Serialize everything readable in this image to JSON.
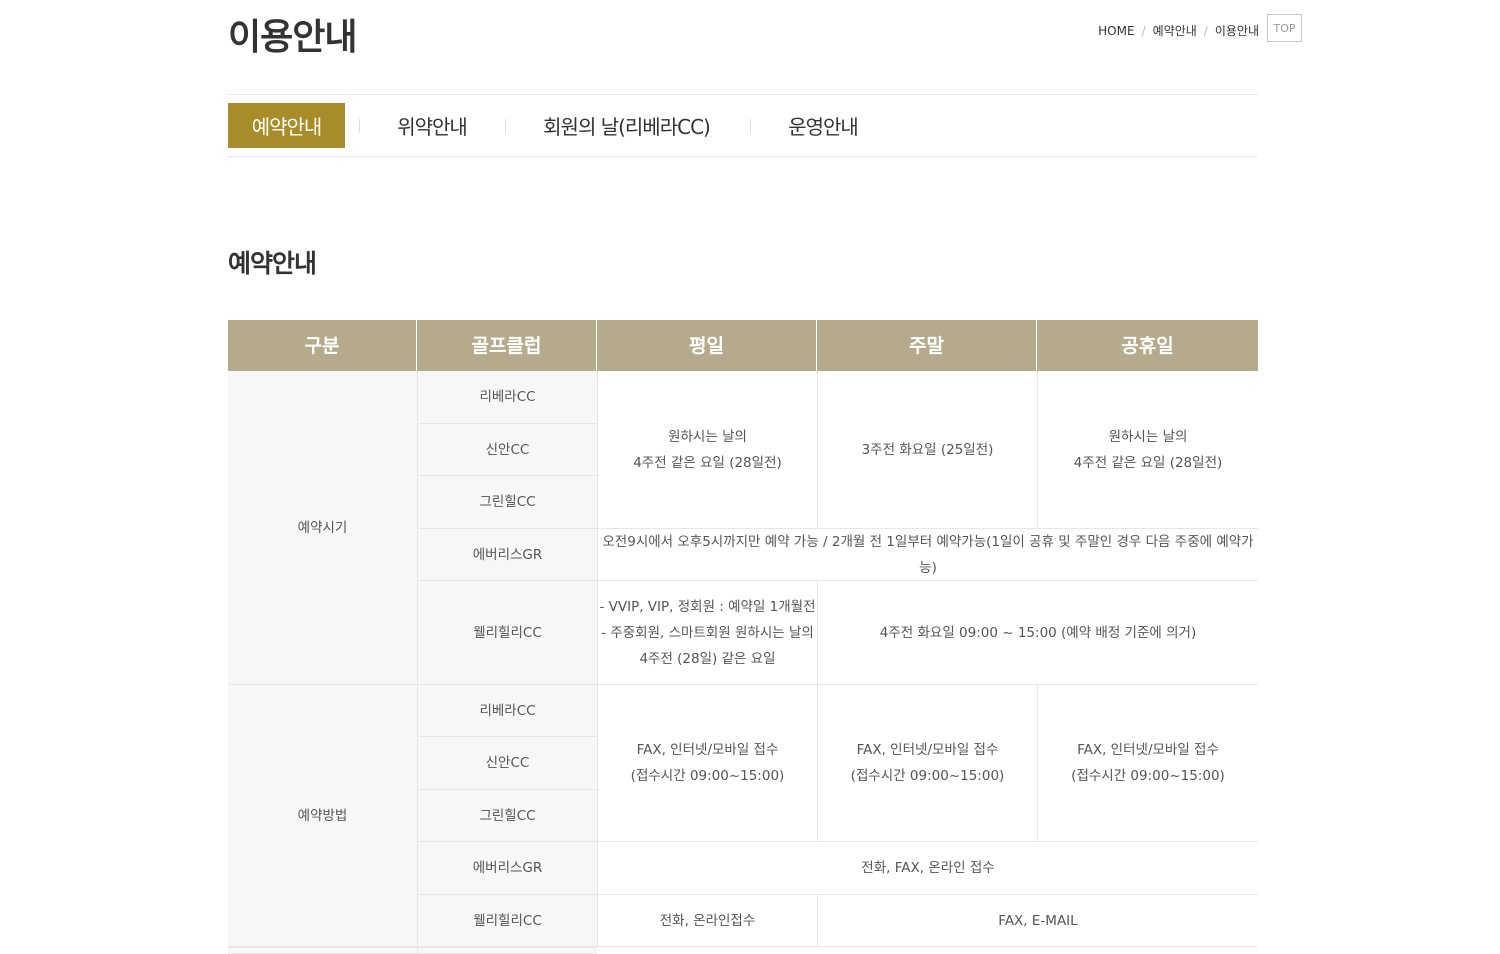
{
  "page": {
    "title": "이용안내"
  },
  "breadcrumb": [
    "HOME",
    "예약안내",
    "이용안내"
  ],
  "top_button": "TOP",
  "tabs": [
    {
      "label": "예약안내",
      "active": true
    },
    {
      "label": "위약안내",
      "active": false
    },
    {
      "label": "회원의 날(리베라CC)",
      "active": false
    },
    {
      "label": "운영안내",
      "active": false
    }
  ],
  "section_title": "예약안내",
  "colors": {
    "accent": "#a88c2a",
    "table_header": "#b5ab8c",
    "cell_bg": "#f7f7f7",
    "border": "#e6e6e6"
  },
  "table": {
    "headers": [
      "구분",
      "골프클럽",
      "평일",
      "주말",
      "공휴일"
    ],
    "categories": [
      "예약시기",
      "예약방법"
    ],
    "clubs": [
      "리베라CC",
      "신안CC",
      "그린힐CC",
      "에버리스GR",
      "웰리힐리CC"
    ],
    "reservation_time": {
      "group_weekday": [
        "원하시는 날의",
        "4주전 같은 요일 (28일전)"
      ],
      "group_weekend": "3주전 화요일 (25일전)",
      "group_holiday": [
        "원하시는 날의",
        "4주전 같은 요일 (28일전)"
      ],
      "everis": "오전9시에서 오후5시까지만 예약 가능 / 2개월 전 1일부터 예약가능(1일이 공휴 및 주말인 경우 다음 주중에 예약가능)",
      "welli_weekday": [
        "- VVIP, VIP, 정회원 : 예약일 1개월전",
        "- 주중회원, 스마트회원 원하시는 날의",
        "4주전 (28일) 같은 요일"
      ],
      "welli_rest": "4주전 화요일 09:00 ~ 15:00 (예약 배정 기준에 의거)"
    },
    "reservation_method": {
      "group_weekday": [
        "FAX, 인터넷/모바일 접수",
        "(접수시간 09:00~15:00)"
      ],
      "group_weekend": [
        "FAX, 인터넷/모바일 접수",
        "(접수시간 09:00~15:00)"
      ],
      "group_holiday": [
        "FAX, 인터넷/모바일 접수",
        "(접수시간 09:00~15:00)"
      ],
      "everis": "전화, FAX, 온라인 접수",
      "welli_weekday": "전화, 온라인접수",
      "welli_rest": "FAX, E-MAIL"
    }
  }
}
